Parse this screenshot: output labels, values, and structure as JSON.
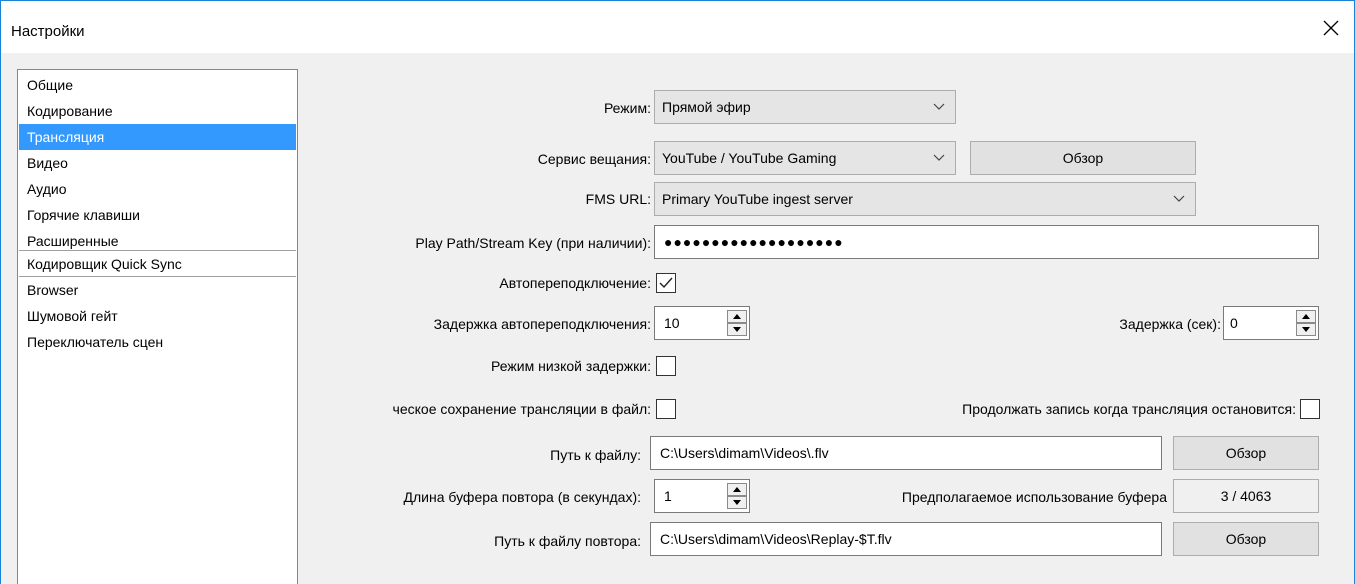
{
  "window": {
    "title": "Настройки"
  },
  "sidebar": {
    "items": [
      {
        "label": "Общие"
      },
      {
        "label": "Кодирование"
      },
      {
        "label": "Трансляция"
      },
      {
        "label": "Видео"
      },
      {
        "label": "Аудио"
      },
      {
        "label": "Горячие клавиши"
      },
      {
        "label": "Расширенные"
      },
      {
        "label": "Кодировщик Quick Sync"
      },
      {
        "label": "Browser"
      },
      {
        "label": "Шумовой гейт"
      },
      {
        "label": "Переключатель сцен"
      }
    ],
    "selected": "Трансляция"
  },
  "form": {
    "mode": {
      "label": "Режим:",
      "value": "Прямой эфир"
    },
    "service": {
      "label": "Сервис вещания:",
      "value": "YouTube / YouTube Gaming",
      "browse": "Обзор"
    },
    "fms_url": {
      "label": "FMS URL:",
      "value": "Primary YouTube ingest server"
    },
    "stream_key": {
      "label": "Play Path/Stream Key (при наличии):",
      "value": "●●●●●●●●●●●●●●●●●●●"
    },
    "auto_reconnect": {
      "label": "Автопереподключение:",
      "checked": true
    },
    "reconnect_delay": {
      "label": "Задержка автопереподключения:",
      "value": "10"
    },
    "delay_sec": {
      "label": "Задержка (сек):",
      "value": "0"
    },
    "low_latency": {
      "label": "Режим низкой задержки:",
      "checked": false
    },
    "auto_save": {
      "label": "ческое сохранение трансляции в файл:",
      "checked": false
    },
    "keep_recording": {
      "label": "Продолжать запись когда трансляция остановится:",
      "checked": false
    },
    "file_path": {
      "label": "Путь к файлу:",
      "value": "C:\\Users\\dimam\\Videos\\.flv",
      "browse": "Обзор"
    },
    "replay_buffer": {
      "label": "Длина буфера повтора (в секундах):",
      "value": "1"
    },
    "buffer_usage": {
      "label": "Предполагаемое использование буфера",
      "value": "3 / 4063"
    },
    "replay_path": {
      "label": "Путь к файлу повтора:",
      "value": "C:\\Users\\dimam\\Videos\\Replay-$T.flv",
      "browse": "Обзор"
    }
  }
}
